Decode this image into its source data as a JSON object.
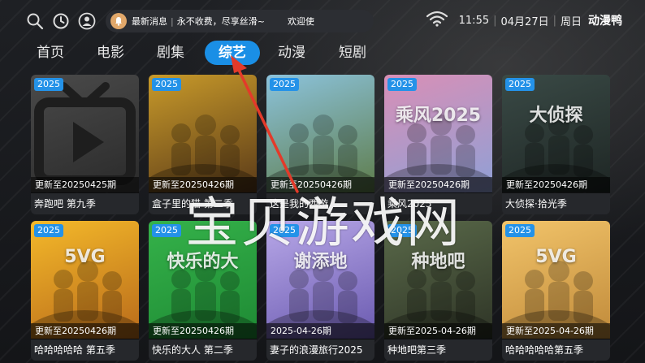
{
  "topbar": {
    "icons": [
      "search-icon",
      "history-icon",
      "user-icon"
    ],
    "ticker": {
      "bell_icon": "bell-icon",
      "news_label": "最新消息",
      "separator": "|",
      "message": "永不收费，尽享丝滑~",
      "message_tail": "欢迎使"
    },
    "status": {
      "wifi_icon": "wifi-icon",
      "time": "11:55",
      "date": "04月27日",
      "weekday": "周日",
      "divider": "|",
      "brand": "动漫鸭"
    }
  },
  "nav": {
    "tabs": [
      {
        "label": "首页",
        "active": false
      },
      {
        "label": "电影",
        "active": false
      },
      {
        "label": "剧集",
        "active": false
      },
      {
        "label": "综艺",
        "active": true
      },
      {
        "label": "动漫",
        "active": false
      },
      {
        "label": "短剧",
        "active": false
      }
    ],
    "accent_color": "#1a8fe6"
  },
  "grid": {
    "items": [
      {
        "year": "2025",
        "update": "更新至20250425期",
        "title": "奔跑吧 第九季",
        "poster_colors": [
          "#4a4a4a",
          "#2a2a2a"
        ],
        "placeholder": true
      },
      {
        "year": "2025",
        "update": "更新至20250426期",
        "title": "盒子里的猫 第二季",
        "poster_colors": [
          "#c89a2a",
          "#5a3a18"
        ]
      },
      {
        "year": "2025",
        "update": "更新至20250426期",
        "title": "这是我的西游",
        "poster_colors": [
          "#8cc3dc",
          "#5e7c4a"
        ]
      },
      {
        "year": "2025",
        "update": "更新至20250426期",
        "title": "乘风2025",
        "poster_colors": [
          "#d98fb6",
          "#8fa0d6"
        ],
        "poster_text": "乘风2025"
      },
      {
        "year": "2025",
        "update": "更新至20250426期",
        "title": "大侦探·拾光季",
        "poster_colors": [
          "#3a4a46",
          "#1e2624"
        ],
        "poster_text": "大侦探"
      },
      {
        "year": "2025",
        "update": "更新至20250426期",
        "title": "哈哈哈哈哈 第五季",
        "poster_colors": [
          "#f4b92a",
          "#b86a1a"
        ],
        "poster_text": "5VG"
      },
      {
        "year": "2025",
        "update": "更新至20250426期",
        "title": "快乐的大人 第二季",
        "poster_colors": [
          "#35b24a",
          "#1e8a34"
        ],
        "poster_text": "快乐的大"
      },
      {
        "year": "2025",
        "update": "2025-04-26期",
        "title": "妻子的浪漫旅行2025",
        "poster_colors": [
          "#b8a8e8",
          "#6a5ab0"
        ],
        "poster_text": "谢添地"
      },
      {
        "year": "2025",
        "update": "更新至2025-04-26期",
        "title": "种地吧第三季",
        "poster_colors": [
          "#5a6a4a",
          "#2e3426"
        ],
        "poster_text": "种地吧"
      },
      {
        "year": "2025",
        "update": "更新至2025-04-26期",
        "title": "哈哈哈哈哈第五季",
        "poster_colors": [
          "#f2c46a",
          "#c08a3a"
        ],
        "poster_text": "5VG"
      }
    ]
  },
  "watermark": "宝贝游戏网"
}
